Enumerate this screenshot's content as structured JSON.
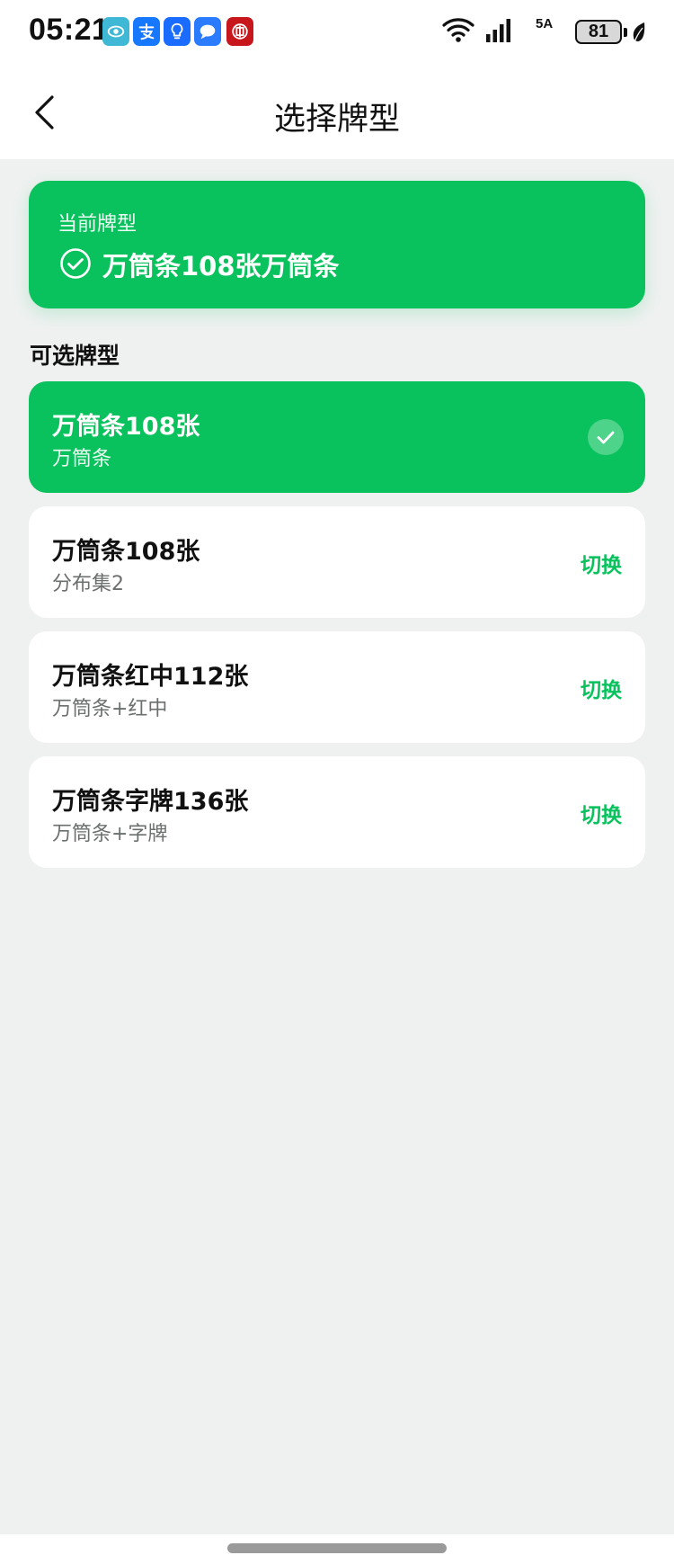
{
  "status_bar": {
    "time": "05:21",
    "network": "5A",
    "battery": "81",
    "app_icons": [
      "eye-app-icon",
      "alipay-icon",
      "bulb-app-icon",
      "chat-app-icon",
      "bank-app-icon"
    ],
    "icon_colors": [
      "#3fb8d6",
      "#1677ff",
      "#1a6bff",
      "#2b7bff",
      "#c8161d"
    ]
  },
  "header": {
    "title": "选择牌型"
  },
  "current": {
    "label": "当前牌型",
    "value": "万筒条108张万筒条"
  },
  "section_title": "可选牌型",
  "options": [
    {
      "name": "万筒条108张",
      "sub": "万筒条",
      "selected": true
    },
    {
      "name": "万筒条108张",
      "sub": "分布集2",
      "action": "切换"
    },
    {
      "name": "万筒条红中112张",
      "sub": "万筒条+红中",
      "action": "切换"
    },
    {
      "name": "万筒条字牌136张",
      "sub": "万筒条+字牌",
      "action": "切换"
    }
  ],
  "colors": {
    "accent": "#0ac25d",
    "background": "#eef1f0"
  }
}
